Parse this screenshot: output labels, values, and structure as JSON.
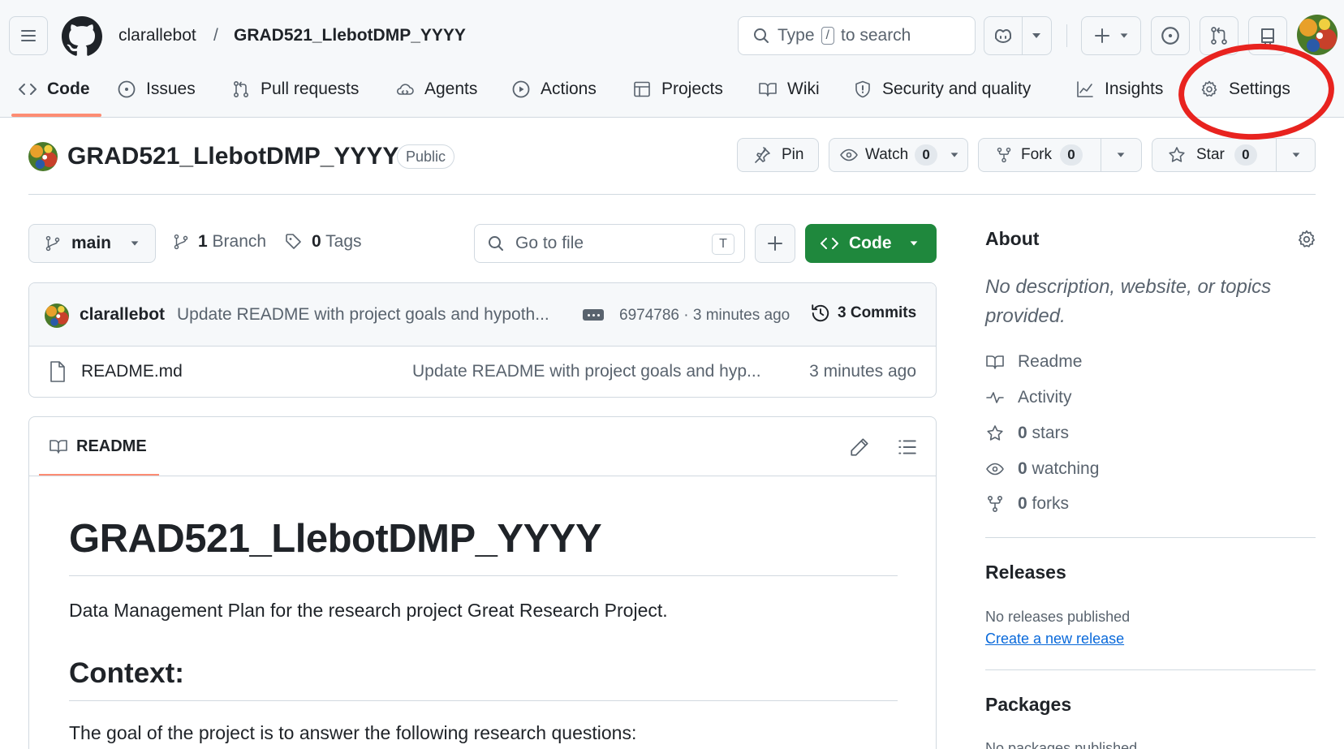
{
  "header": {
    "owner": "clarallebot",
    "separator": "/",
    "repo": "GRAD521_LlebotDMP_YYYY",
    "search": {
      "prefix": "Type",
      "key": "/",
      "suffix": "to search"
    }
  },
  "nav": {
    "tabs": [
      {
        "label": "Code",
        "icon": "code-icon",
        "selected": true
      },
      {
        "label": "Issues",
        "icon": "issue-icon"
      },
      {
        "label": "Pull requests",
        "icon": "pull-request-icon"
      },
      {
        "label": "Agents",
        "icon": "agents-icon"
      },
      {
        "label": "Actions",
        "icon": "play-icon"
      },
      {
        "label": "Projects",
        "icon": "table-icon"
      },
      {
        "label": "Wiki",
        "icon": "book-icon"
      },
      {
        "label": "Security and quality",
        "icon": "shield-icon"
      },
      {
        "label": "Insights",
        "icon": "graph-icon"
      },
      {
        "label": "Settings",
        "icon": "gear-icon"
      }
    ]
  },
  "repo": {
    "title": "GRAD521_LlebotDMP_YYYY",
    "visibility": "Public",
    "pin_label": "Pin",
    "watch_label": "Watch",
    "watch_count": "0",
    "fork_label": "Fork",
    "fork_count": "0",
    "star_label": "Star",
    "star_count": "0"
  },
  "filenav": {
    "branch": "main",
    "branch_count": "1",
    "branch_label": "Branch",
    "tag_count": "0",
    "tag_label": "Tags",
    "gofile_placeholder": "Go to file",
    "gofile_key": "T",
    "code_label": "Code"
  },
  "commit": {
    "author": "clarallebot",
    "message": "Update README with project goals and hypoth...",
    "sha_time": "6974786 · 3 minutes ago",
    "commits_label": "3 Commits"
  },
  "files": [
    {
      "name": "README.md",
      "commit": "Update README with project goals and hyp...",
      "age": "3 minutes ago"
    }
  ],
  "readme": {
    "tab_label": "README",
    "h1": "GRAD521_LlebotDMP_YYYY",
    "p1": "Data Management Plan for the research project Great Research Project.",
    "h2": "Context:",
    "p2": "The goal of the project is to answer the following research questions:"
  },
  "sidebar": {
    "about_title": "About",
    "about_desc": "No description, website, or topics provided.",
    "readme": "Readme",
    "activity": "Activity",
    "stars_count": "0",
    "stars_label": "stars",
    "watching_count": "0",
    "watching_label": "watching",
    "forks_count": "0",
    "forks_label": "forks",
    "releases_title": "Releases",
    "releases_none": "No releases published",
    "releases_create": "Create a new release",
    "packages_title": "Packages",
    "packages_none": "No packages published"
  },
  "colors": {
    "accent_underline": "#fd8c73",
    "code_button": "#1f883d",
    "link": "#0969da",
    "annotation": "#e8231f"
  }
}
